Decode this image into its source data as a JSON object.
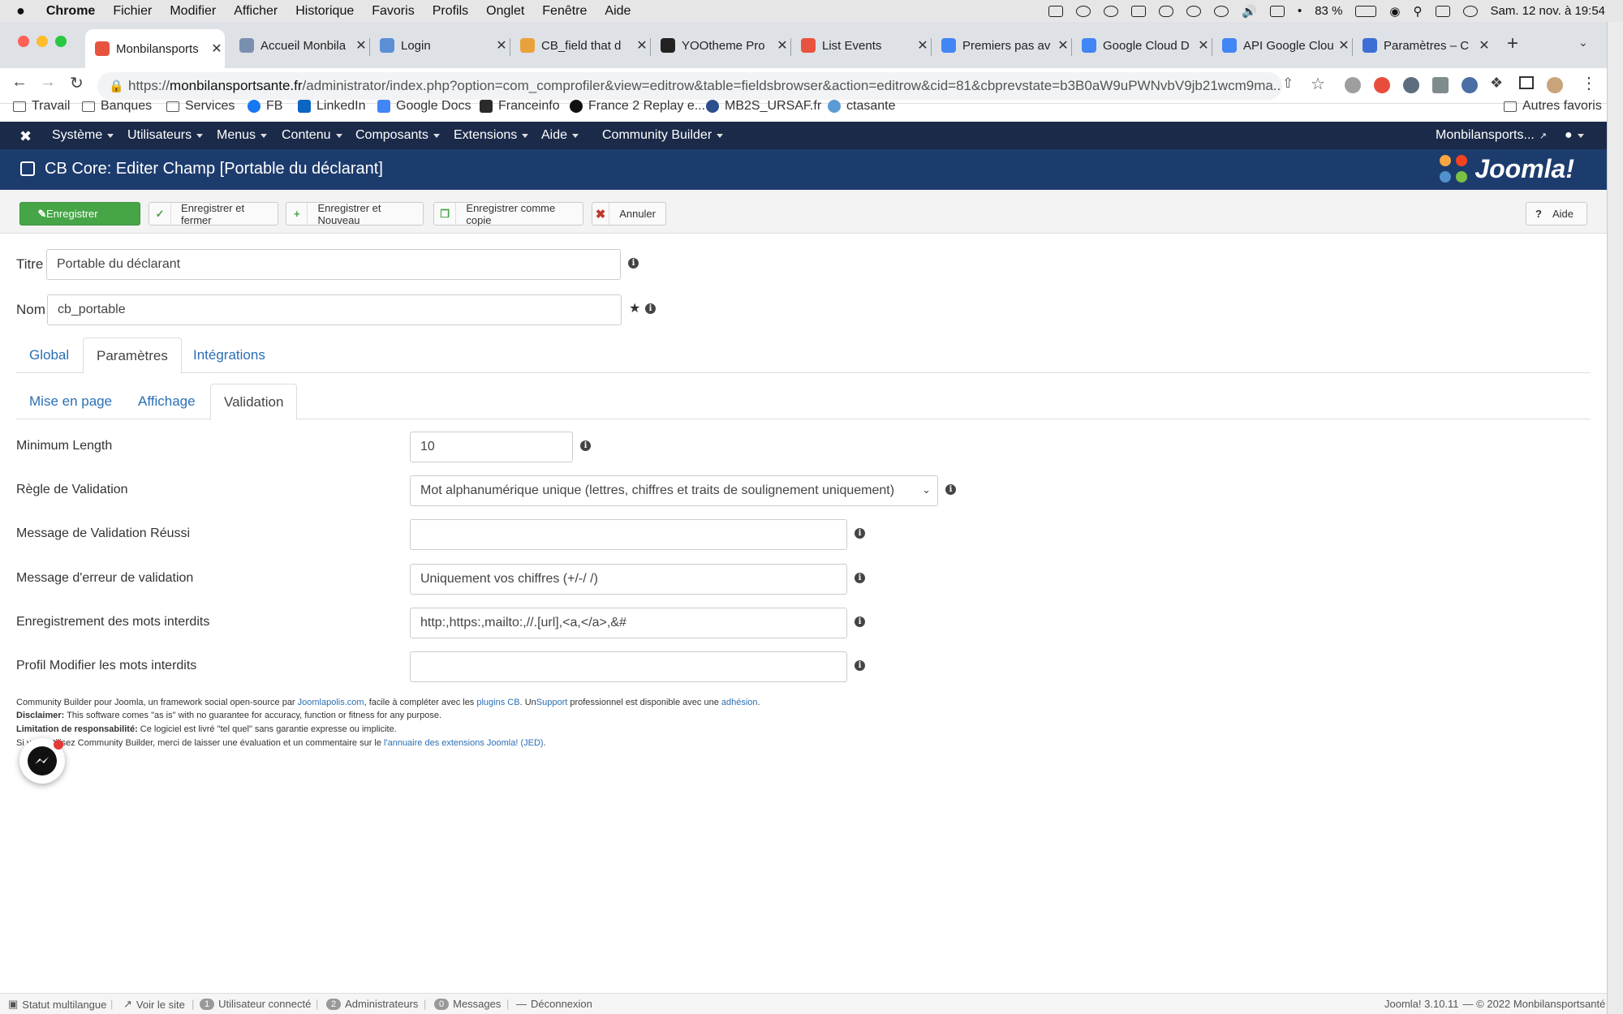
{
  "mac_menu": {
    "apple": "",
    "app": "Chrome",
    "items": [
      "Fichier",
      "Modifier",
      "Afficher",
      "Historique",
      "Favoris",
      "Profils",
      "Onglet",
      "Fenêtre",
      "Aide"
    ],
    "battery": "83 %",
    "clock": "Sam. 12 nov. à 19:54"
  },
  "tabs": [
    {
      "title": "Monbilansports",
      "color": "#e8533f"
    },
    {
      "title": "Accueil Monbila",
      "color": "#7a8fb0"
    },
    {
      "title": "Login",
      "color": "#5b8fd6"
    },
    {
      "title": "CB_field that d",
      "color": "#e9a23b"
    },
    {
      "title": "YOOtheme Pro",
      "color": "#222"
    },
    {
      "title": "List Events",
      "color": "#e8533f"
    },
    {
      "title": "Premiers pas av",
      "color": "#4285f4"
    },
    {
      "title": "Google Cloud D",
      "color": "#4285f4"
    },
    {
      "title": "API Google Clou",
      "color": "#4285f4"
    },
    {
      "title": "Paramètres – C",
      "color": "#3c6fd6"
    }
  ],
  "url": {
    "scheme": "https://",
    "host": "monbilansportsante.fr",
    "path": "/administrator/index.php?option=com_comprofiler&view=editrow&table=fieldsbrowser&action=editrow&cid=81&cbprevstate=b3B0aW9uPWNvbV9jb21wcm9ma..."
  },
  "bookmarks": [
    "Travail",
    "Banques",
    "Services",
    "FB",
    "LinkedIn",
    "Google Docs",
    "Franceinfo",
    "France 2 Replay e...",
    "MB2S_URSAF.fr",
    "ctasante"
  ],
  "bookmarks_other": "Autres favoris",
  "jnav": {
    "items": [
      "Système",
      "Utilisateurs",
      "Menus",
      "Contenu",
      "Composants",
      "Extensions",
      "Aide",
      "Community Builder"
    ],
    "site": "Monbilansports..."
  },
  "header": {
    "title": "CB Core: Editer Champ [Portable du déclarant]",
    "logo": "Joomla!"
  },
  "toolbar": {
    "save": "Enregistrer",
    "save_close": "Enregistrer et fermer",
    "save_new": "Enregistrer et Nouveau",
    "save_copy": "Enregistrer comme copie",
    "cancel": "Annuler",
    "help": "Aide"
  },
  "form": {
    "title_label": "Titre",
    "title_value": "Portable du déclarant",
    "name_label": "Nom",
    "name_value": "cb_portable"
  },
  "main_tabs": [
    "Global",
    "Paramètres",
    "Intégrations"
  ],
  "sub_tabs": [
    "Mise en page",
    "Affichage",
    "Validation"
  ],
  "validation": {
    "min_length_label": "Minimum Length",
    "min_length_value": "10",
    "rule_label": "Règle de Validation",
    "rule_value": "Mot alphanumérique unique (lettres, chiffres et traits de soulignement uniquement)",
    "success_label": "Message de Validation Réussi",
    "success_value": "",
    "error_label": "Message d'erreur de validation",
    "error_value": "Uniquement vos chiffres (+/-/ /)",
    "forbidden_reg_label": "Enregistrement des mots interdits",
    "forbidden_reg_value": "http:,https:,mailto:,//.[url],<a,</a>,&#",
    "forbidden_edit_label": "Profil Modifier les mots interdits",
    "forbidden_edit_value": ""
  },
  "footer": {
    "l1a": "Community Builder pour Joomla, un framework social open-source par ",
    "l1b": "Joomlapolis.com",
    "l1c": ", facile à compléter avec les ",
    "l1d": "plugins CB",
    "l1e": ". Un",
    "l1f": "Support",
    "l1g": " professionnel est disponible avec une ",
    "l1h": "adhésion",
    "l1i": ".",
    "l2a": "Disclaimer:",
    "l2b": " This software comes \"as is\" with no guarantee for accuracy, function or fitness for any purpose.",
    "l3a": "Limitation de responsabilité:",
    "l3b": " Ce logiciel est livré \"tel quel\" sans garantie expresse ou implicite.",
    "l4a": "Si vous utilisez Community Builder, merci de laisser une évaluation et un commentaire sur le ",
    "l4b": "l'annuaire des extensions Joomla! (JED)",
    "l4c": "."
  },
  "status": {
    "multilang": "Statut multilangue",
    "view_site": "Voir le site",
    "users_count": "1",
    "users": "Utilisateur connecté",
    "admins_count": "2",
    "admins": "Administrateurs",
    "msg_count": "0",
    "messages": "Messages",
    "logout": "Déconnexion",
    "version": "Joomla! 3.10.11",
    "copyright": "— © 2022 Monbilansportsanté"
  }
}
